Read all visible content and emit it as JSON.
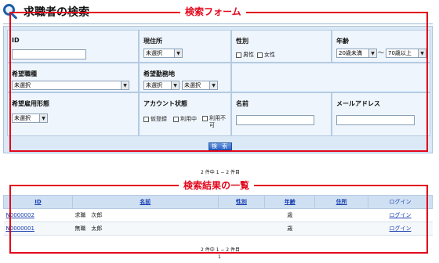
{
  "page": {
    "title": "求職者の検索"
  },
  "annotations": {
    "form_label": "検索フォーム",
    "results_label": "検索結果の一覧"
  },
  "form": {
    "id_label": "ID",
    "id_value": "",
    "current_address_label": "現住所",
    "current_address_value": "未選択",
    "gender_label": "性別",
    "gender_options": [
      "男性",
      "女性"
    ],
    "age_label": "年齢",
    "age_from": "20歳未満",
    "age_sep": "～",
    "age_to": "70歳以上",
    "desired_job_label": "希望職種",
    "desired_job_value": "未選択",
    "desired_location_label": "希望勤務地",
    "desired_location_1": "未選択",
    "desired_location_2": "未選択",
    "employment_label": "希望雇用形態",
    "employment_value": "未選択",
    "account_status_label": "アカウント状態",
    "account_status_options": [
      "仮登録",
      "利用中",
      "利用不可"
    ],
    "name_label": "名前",
    "name_value": "",
    "email_label": "メールアドレス",
    "email_value": "",
    "search_button": "検 索"
  },
  "results": {
    "count_top": "2 件中 1 − 2 件目",
    "count_bottom": "2 件中 1 − 2 件目",
    "page_number": "1",
    "headers": [
      "ID",
      "名前",
      "性別",
      "年齢",
      "住所",
      "ログイン"
    ],
    "rows": [
      {
        "id": "N0000002",
        "name": "求職　次郎",
        "gender": "",
        "age": "歳",
        "address": "",
        "login": "ログイン"
      },
      {
        "id": "N0000001",
        "name": "無職　太郎",
        "gender": "",
        "age": "歳",
        "address": "",
        "login": "ログイン"
      }
    ]
  }
}
